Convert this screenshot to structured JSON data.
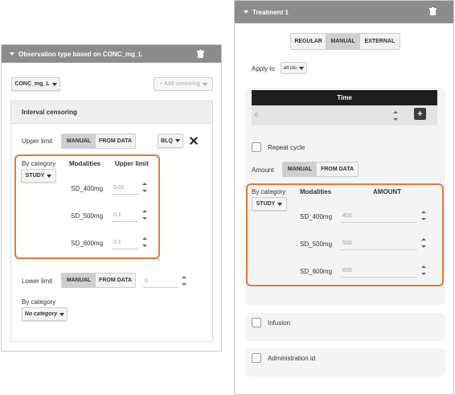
{
  "left_panel": {
    "title": "Observation type based on CONC_mg_L",
    "variable_dropdown": "CONC_mg_L",
    "add_censoring": "+ Add censoring",
    "interval_heading": "Interval censoring",
    "upper_limit": {
      "label": "Upper limit",
      "manual": "MANUAL",
      "from_data": "FROM DATA",
      "active": "MANUAL",
      "blq": "BLQ"
    },
    "by_category": {
      "label": "By category",
      "dropdown": "STUDY",
      "col_modalities": "Modalities",
      "col_value": "Upper limit",
      "rows": [
        {
          "modality": "SD_400mg",
          "value": "0.01"
        },
        {
          "modality": "SD_500mg",
          "value": "0.1"
        },
        {
          "modality": "SD_600mg",
          "value": "0.1"
        }
      ]
    },
    "lower_limit": {
      "label": "Lower limit",
      "manual": "MANUAL",
      "from_data": "FROM DATA",
      "value": "0"
    },
    "by_category_2": {
      "label": "By category",
      "dropdown": "No category"
    }
  },
  "right_panel": {
    "title": "Treatment 1",
    "types": [
      "REGULAR",
      "MANUAL",
      "EXTERNAL"
    ],
    "active_type": "MANUAL",
    "apply_to_label": "Apply to",
    "apply_to_value": "all ids",
    "time_header": "Time",
    "time_value": "0",
    "add_symbol": "+",
    "repeat_cycle": "Repeat cycle",
    "amount_label": "Amount",
    "amount_manual": "MANUAL",
    "amount_from_data": "FROM DATA",
    "by_category": {
      "label": "By category",
      "dropdown": "STUDY",
      "col_modalities": "Modalities",
      "col_value": "AMOUNT",
      "rows": [
        {
          "modality": "SD_400mg",
          "value": "400"
        },
        {
          "modality": "SD_500mg",
          "value": "500"
        },
        {
          "modality": "SD_600mg",
          "value": "600"
        }
      ]
    },
    "infusion": "Infusion",
    "administration_id": "Administration id"
  },
  "colors": {
    "header": "#8c8c8c",
    "highlight": "#e07b39",
    "time_header": "#1f1f1f"
  }
}
